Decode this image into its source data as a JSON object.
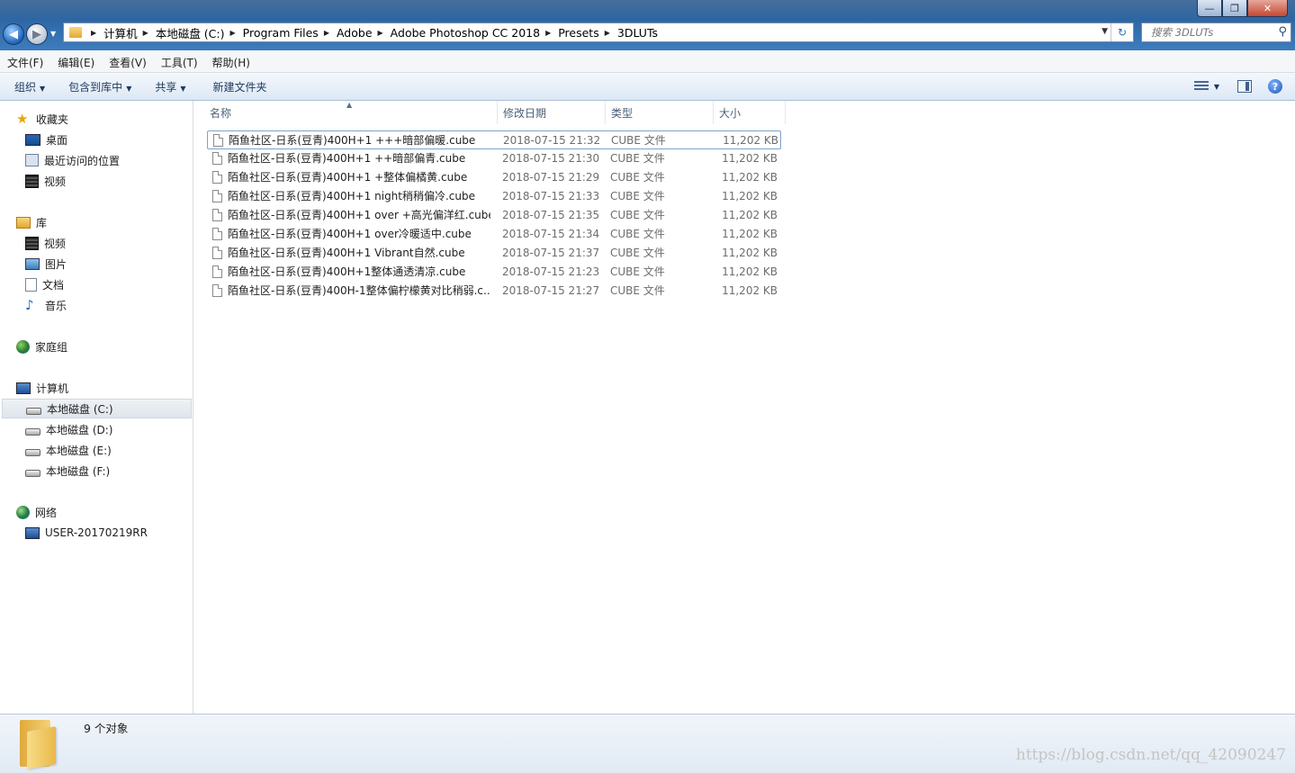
{
  "window": {
    "title_buttons": [
      "minimize",
      "maximize",
      "close"
    ]
  },
  "address": {
    "crumbs": [
      "计算机",
      "本地磁盘 (C:)",
      "Program Files",
      "Adobe",
      "Adobe Photoshop CC 2018",
      "Presets",
      "3DLUTs"
    ]
  },
  "search": {
    "placeholder": "搜索 3DLUTs"
  },
  "menu": {
    "items": [
      "文件(F)",
      "编辑(E)",
      "查看(V)",
      "工具(T)",
      "帮助(H)"
    ]
  },
  "toolbar": {
    "organize": "组织",
    "include_library": "包含到库中",
    "share": "共享",
    "new_folder": "新建文件夹"
  },
  "sidebar": {
    "favorites": "收藏夹",
    "desktop": "桌面",
    "recent": "最近访问的位置",
    "fav_video": "视频",
    "libraries": "库",
    "lib_video": "视频",
    "lib_pictures": "图片",
    "lib_docs": "文档",
    "lib_music": "音乐",
    "homegroup": "家庭组",
    "computer": "计算机",
    "drive_c": "本地磁盘 (C:)",
    "drive_d": "本地磁盘 (D:)",
    "drive_e": "本地磁盘 (E:)",
    "drive_f": "本地磁盘 (F:)",
    "network": "网络",
    "net_pc": "USER-20170219RR"
  },
  "columns": {
    "name": "名称",
    "date": "修改日期",
    "type": "类型",
    "size": "大小"
  },
  "files": [
    {
      "name": "陌鱼社区-日系(豆青)400H+1 +++暗部偏暖.cube",
      "date": "2018-07-15 21:32",
      "type": "CUBE 文件",
      "size": "11,202 KB"
    },
    {
      "name": "陌鱼社区-日系(豆青)400H+1 ++暗部偏青.cube",
      "date": "2018-07-15 21:30",
      "type": "CUBE 文件",
      "size": "11,202 KB"
    },
    {
      "name": "陌鱼社区-日系(豆青)400H+1 +整体偏橘黄.cube",
      "date": "2018-07-15 21:29",
      "type": "CUBE 文件",
      "size": "11,202 KB"
    },
    {
      "name": "陌鱼社区-日系(豆青)400H+1 night稍稍偏冷.cube",
      "date": "2018-07-15 21:33",
      "type": "CUBE 文件",
      "size": "11,202 KB"
    },
    {
      "name": "陌鱼社区-日系(豆青)400H+1 over +高光偏洋红.cube",
      "date": "2018-07-15 21:35",
      "type": "CUBE 文件",
      "size": "11,202 KB"
    },
    {
      "name": "陌鱼社区-日系(豆青)400H+1 over冷暖适中.cube",
      "date": "2018-07-15 21:34",
      "type": "CUBE 文件",
      "size": "11,202 KB"
    },
    {
      "name": "陌鱼社区-日系(豆青)400H+1 Vibrant自然.cube",
      "date": "2018-07-15 21:37",
      "type": "CUBE 文件",
      "size": "11,202 KB"
    },
    {
      "name": "陌鱼社区-日系(豆青)400H+1整体通透清凉.cube",
      "date": "2018-07-15 21:23",
      "type": "CUBE 文件",
      "size": "11,202 KB"
    },
    {
      "name": "陌鱼社区-日系(豆青)400H-1整体偏柠檬黄对比稍弱.c...",
      "date": "2018-07-15 21:27",
      "type": "CUBE 文件",
      "size": "11,202 KB"
    }
  ],
  "status": {
    "count": "9 个对象"
  },
  "watermark": "https://blog.csdn.net/qq_42090247"
}
